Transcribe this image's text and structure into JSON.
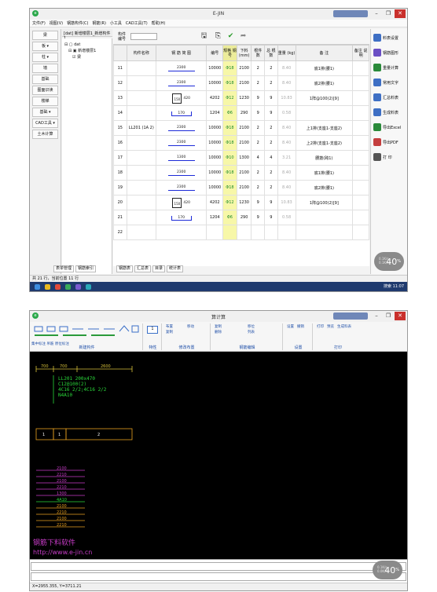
{
  "w1": {
    "title": "E-JIN",
    "menu": [
      "文件(F)",
      "视图(V)",
      "钢筋构件(C)",
      "钢筋(R)",
      "小工具",
      "CAD工具(T)",
      "帮助(H)"
    ],
    "left_buttons": [
      "梁",
      "板 ▾",
      "柱 ▾",
      "墙",
      "基础",
      "图面识读",
      "楼梯",
      "基础 ▾",
      "CAD工具 ▾",
      "土木计算"
    ],
    "tree_title": "[dat] 新增楼层1_新增构件1",
    "tree": [
      "⊟ ▢ dat",
      "⊟ ▣ 新增楼层1",
      "☑ 梁"
    ],
    "toolbar_label": "构件编号",
    "headers": [
      "",
      "构件名称",
      "钢 筋 简 图",
      "编号",
      "规格 钢号",
      "下料 (mm)",
      "根件 数",
      "总 根数",
      "重量 (kg)",
      "备 注",
      "备注 说明"
    ],
    "rows": [
      {
        "n": "11",
        "name": "",
        "len": "2300",
        "code": "10000",
        "spec": "Φ18",
        "cut": "2100",
        "per": "2",
        "tot": "2",
        "wt": "8.40",
        "note": "底1排(腰1)",
        "shape": "bar"
      },
      {
        "n": "12",
        "name": "",
        "len": "2300",
        "code": "10000",
        "spec": "Φ18",
        "cut": "2100",
        "per": "2",
        "tot": "2",
        "wt": "8.40",
        "note": "底2排(腰1)",
        "shape": "bar"
      },
      {
        "n": "13",
        "name": "",
        "len": "420",
        "side": "150",
        "code": "4202",
        "spec": "Φ12",
        "cut": "1230",
        "per": "9",
        "tot": "9",
        "wt": "10.83",
        "note": "1阵@100(2)[9]",
        "shape": "stir"
      },
      {
        "n": "14",
        "name": "",
        "len": "170",
        "code": "1204",
        "spec": "Φ6",
        "cut": "290",
        "per": "9",
        "tot": "9",
        "wt": "0.58",
        "note": "",
        "shape": "hook"
      },
      {
        "n": "15",
        "name": "LL201 (1A 2)",
        "len": "2300",
        "code": "10000",
        "spec": "Φ18",
        "cut": "2100",
        "per": "2",
        "tot": "2",
        "wt": "8.40",
        "note": "上1排(支座1-支座2)",
        "shape": "bar"
      },
      {
        "n": "16",
        "name": "",
        "len": "2300",
        "code": "10000",
        "spec": "Φ18",
        "cut": "2100",
        "per": "2",
        "tot": "2",
        "wt": "8.40",
        "note": "上2排(支座1-支座2)",
        "shape": "bar"
      },
      {
        "n": "17",
        "name": "",
        "len": "1300",
        "code": "10000",
        "spec": "Φ10",
        "cut": "1300",
        "per": "4",
        "tot": "4",
        "wt": "3.21",
        "note": "腰筋(跨1)",
        "shape": "bar"
      },
      {
        "n": "18",
        "name": "",
        "len": "2300",
        "code": "10000",
        "spec": "Φ18",
        "cut": "2100",
        "per": "2",
        "tot": "2",
        "wt": "8.40",
        "note": "底1排(腰1)",
        "shape": "bar"
      },
      {
        "n": "19",
        "name": "",
        "len": "2300",
        "code": "10000",
        "spec": "Φ18",
        "cut": "2100",
        "per": "2",
        "tot": "2",
        "wt": "8.40",
        "note": "底2排(腰1)",
        "shape": "bar"
      },
      {
        "n": "20",
        "name": "",
        "len": "420",
        "side": "150",
        "code": "4202",
        "spec": "Φ12",
        "cut": "1230",
        "per": "9",
        "tot": "9",
        "wt": "10.83",
        "note": "1阵@100(2)[9]",
        "shape": "stir"
      },
      {
        "n": "21",
        "name": "",
        "len": "170",
        "code": "1204",
        "spec": "Φ6",
        "cut": "290",
        "per": "9",
        "tot": "9",
        "wt": "0.58",
        "note": "",
        "shape": "hook"
      },
      {
        "n": "22",
        "name": "",
        "len": "",
        "code": "",
        "spec": "",
        "cut": "",
        "per": "",
        "tot": "",
        "wt": "",
        "note": "",
        "shape": ""
      }
    ],
    "right_buttons": [
      "料表设置",
      "钢筋图形",
      "重量计算",
      "常用文字",
      "汇总料表",
      "生成料表",
      "导出Excel",
      "导出PDF",
      "打 印"
    ],
    "tabs_left": [
      "表单管理",
      "钢筋索引"
    ],
    "tabs_right": [
      "钢筋表",
      "汇总表",
      "目录",
      "统计表"
    ],
    "status": "共 21 行，当前位置 11 行",
    "badge": {
      "value": "40",
      "unit": "%",
      "up": "0.1K/s",
      "down": "0.1K/s"
    },
    "tray": "搜索  11:07"
  },
  "w2": {
    "title": "算计算",
    "ribbon": [
      {
        "name": "新建构件",
        "items": [
          "集中标注 吊筋 原位标注"
        ]
      },
      {
        "name": "特性",
        "items": [
          ""
        ]
      },
      {
        "name": "修改布置",
        "items": [
          "布置",
          "移动",
          "复制"
        ]
      },
      {
        "name": "钢筋编辑",
        "items": [
          "复制",
          "移位",
          "删除",
          "列表"
        ]
      },
      {
        "name": "设置",
        "items": [
          "设置",
          "撤销"
        ]
      },
      {
        "name": "打印",
        "items": [
          "打印",
          "预览",
          "生成料表"
        ]
      }
    ],
    "drawing": {
      "title": "LL201 200x470",
      "lines": [
        "C12@100(2)",
        "4C16 2/2;4C16 2/2",
        "N4A10"
      ],
      "dims": [
        "700",
        "2600",
        "700"
      ],
      "spans": [
        "1",
        "1",
        "2"
      ],
      "bars": [
        "2100",
        "2210",
        "2100",
        "2210",
        "1300",
        "4A10",
        "2100",
        "2210",
        "2100",
        "2210"
      ]
    },
    "watermark": [
      "钢筋下料软件",
      "http://www.e-jin.cn"
    ],
    "coords": "X=2955.355, Y=3711.21",
    "badge": {
      "value": "40",
      "unit": "%",
      "up": "0.1K/s",
      "down": "0.0K/s"
    }
  }
}
